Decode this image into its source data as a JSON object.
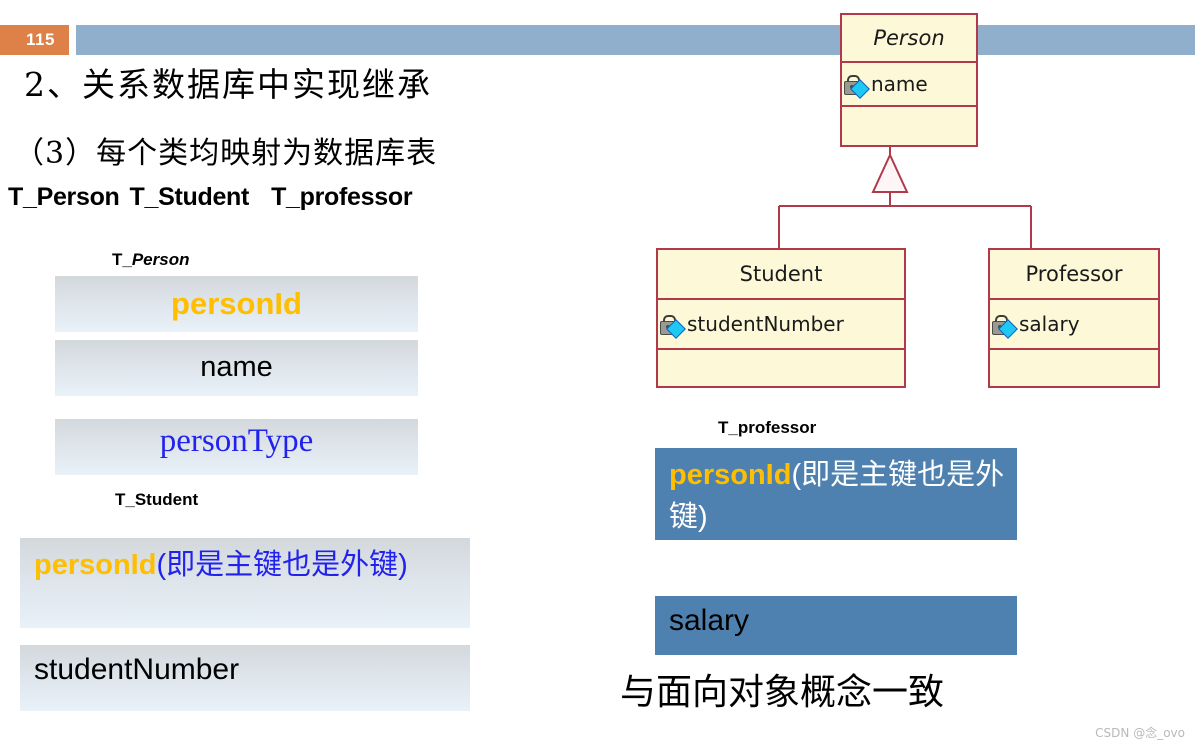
{
  "header": {
    "slide_number": "115",
    "bar_color": "#8FAFCD",
    "badge_color": "#DD8148"
  },
  "headings": {
    "line1": "2、关系数据库中实现继承",
    "line2": "（3）每个类均映射为数据库表",
    "table_names": {
      "first": "T_Person",
      "second": "T_Student",
      "third": "T_professor"
    }
  },
  "tables": {
    "t_person": {
      "caption_prefix": "T_",
      "caption_name": "Person",
      "rows": [
        {
          "text": "personId",
          "color": "#FFBE00"
        },
        {
          "text": "name",
          "color": "#000000"
        },
        {
          "text": "personType",
          "color": "#2222EE"
        }
      ]
    },
    "t_student": {
      "caption_prefix": "T_",
      "caption_name": "Student",
      "row_key_name": "personId",
      "row_key_note": "(即是主键也是外键)",
      "row_second": "studentNumber"
    },
    "t_professor": {
      "caption_prefix": "T_",
      "caption_name": "professor",
      "row_key_name": "personId",
      "row_key_note": "(即是主键也是外键)",
      "row_second": "salary",
      "fill_color": "#4E81AF"
    }
  },
  "uml": {
    "fill_color": "#FCF8D8",
    "border_color": "#B03A4C",
    "classes": {
      "person": {
        "name": "Person",
        "attribute": "name"
      },
      "student": {
        "name": "Student",
        "attribute": "studentNumber"
      },
      "professor": {
        "name": "Professor",
        "attribute": "salary"
      }
    }
  },
  "conclusion": "与面向对象概念一致",
  "watermark": "CSDN @念_ovo"
}
